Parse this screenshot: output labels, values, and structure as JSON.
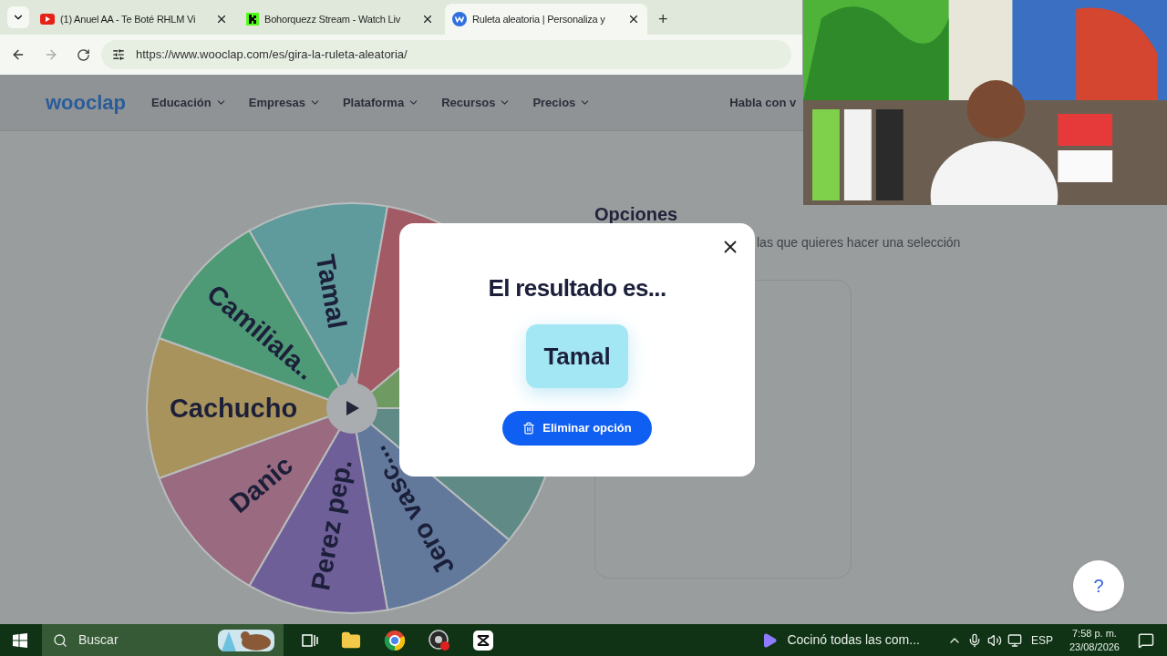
{
  "browser": {
    "tabs": [
      {
        "title": "(1) Anuel AA - Te Boté RHLM Vi",
        "selected": false
      },
      {
        "title": "Bohorquezz Stream - Watch Liv",
        "selected": false
      },
      {
        "title": "Ruleta aleatoria | Personaliza y",
        "selected": true
      }
    ],
    "new_tab": "+",
    "url": "https://www.wooclap.com/es/gira-la-ruleta-aleatoria/"
  },
  "site": {
    "logo": "wooclap",
    "nav": [
      "Educación",
      "Empresas",
      "Plataforma",
      "Recursos",
      "Precios"
    ],
    "nav_right": "Habla con v",
    "options_title": "Opciones",
    "options_text": "las que quieres hacer una selección",
    "help": "?"
  },
  "wheel": {
    "segments": [
      {
        "label": "Cachucho",
        "color": "#a8935c"
      },
      {
        "label": "Camiliala..",
        "color": "#4f9a76"
      },
      {
        "label": "Tamal",
        "color": "#5f9a9c"
      },
      {
        "color": "#a25a64"
      },
      {
        "color": "#6f9a62"
      },
      {
        "color": "#5f8a86"
      },
      {
        "label": "Jero vasc...",
        "color": "#62799c"
      },
      {
        "label": "Perez pep.",
        "color": "#6f5f98"
      },
      {
        "label": "Danic",
        "color": "#9a6a80"
      }
    ]
  },
  "modal": {
    "title": "El resultado es...",
    "result": "Tamal",
    "button": "Eliminar opción"
  },
  "taskbar": {
    "search": "Buscar",
    "notification": "Cocinó todas las com...",
    "language": "ESP",
    "time": "7:58 p. m.",
    "date": "23/08/2026"
  }
}
